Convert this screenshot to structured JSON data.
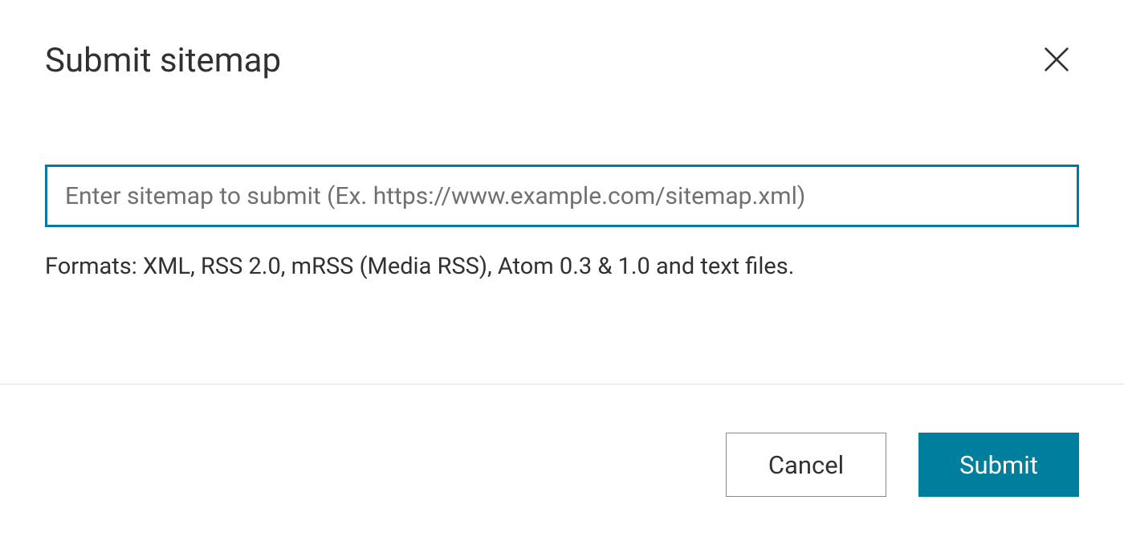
{
  "dialog": {
    "title": "Submit sitemap",
    "input": {
      "placeholder": "Enter sitemap to submit (Ex. https://www.example.com/sitemap.xml)",
      "value": ""
    },
    "formats_text": "Formats: XML, RSS 2.0, mRSS (Media RSS), Atom 0.3 & 1.0 and text files.",
    "buttons": {
      "cancel": "Cancel",
      "submit": "Submit"
    }
  }
}
